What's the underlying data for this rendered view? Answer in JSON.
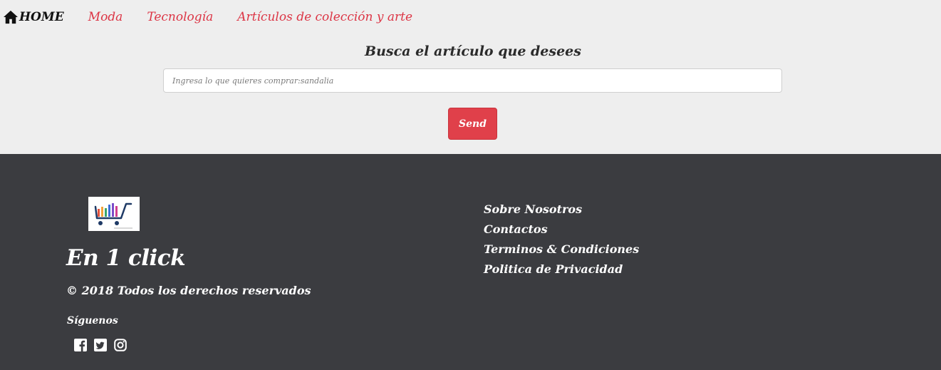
{
  "nav": {
    "home_label": "HOME",
    "links": [
      {
        "label": "Moda"
      },
      {
        "label": "Tecnología"
      },
      {
        "label": "Artículos de colección y arte"
      }
    ]
  },
  "search": {
    "title": "Busca el artículo que desees",
    "placeholder": "Ingresa lo que quieres comprar:sandalia",
    "value": "",
    "button_label": "Send"
  },
  "footer": {
    "brand": "En 1 click",
    "copyright": "© 2018 Todos los derechos reservados",
    "follow_label": "Síguenos",
    "social_icons": [
      "facebook-icon",
      "twitter-icon",
      "instagram-icon"
    ],
    "links": [
      {
        "label": "Sobre Nosotros"
      },
      {
        "label": "Contactos"
      },
      {
        "label": "Terminos & Condiciones"
      },
      {
        "label": "Politica de Privacidad"
      }
    ]
  },
  "colors": {
    "accent": "#dc3545",
    "button": "#e0404a",
    "header_bg": "#eeeeee",
    "footer_bg": "#3b3c40"
  }
}
